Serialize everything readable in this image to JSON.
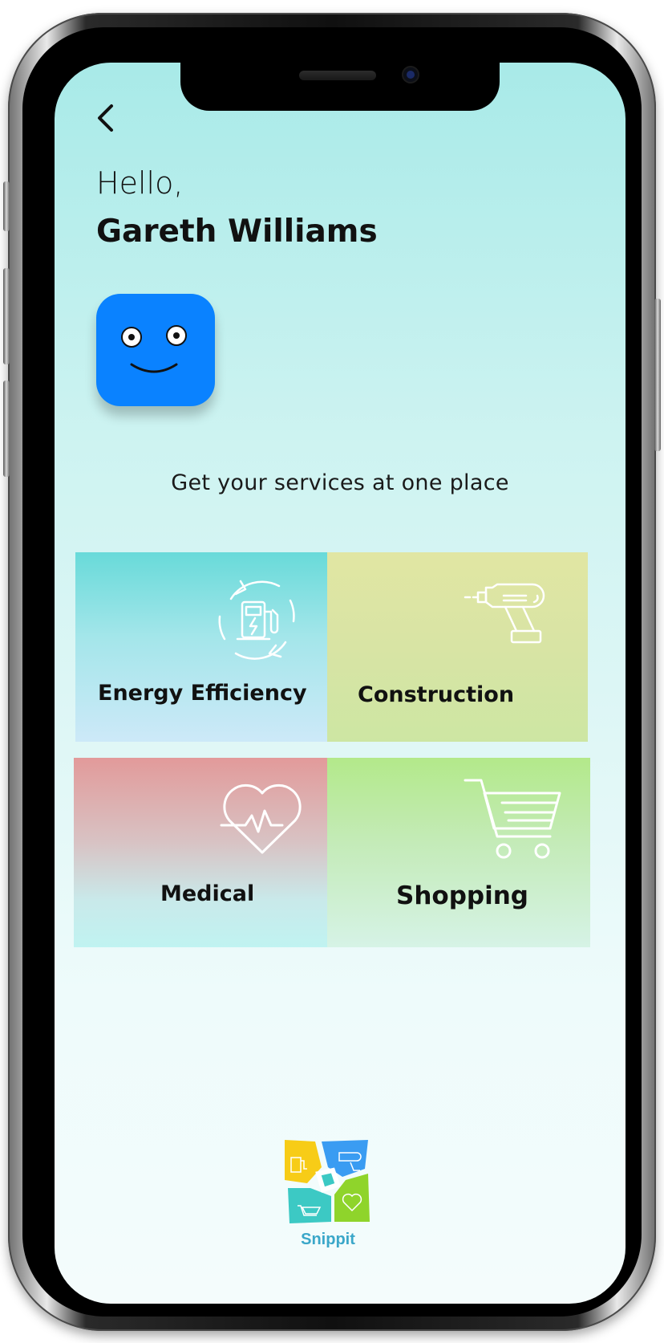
{
  "header": {
    "back_icon": "chevron-left-icon",
    "greeting": "Hello,",
    "user_name": "Gareth Williams"
  },
  "avatar": {
    "icon": "smiley-face-icon",
    "color": "#0a82ff"
  },
  "tagline": "Get your services at one place",
  "services": [
    {
      "label": "Energy Efficiency",
      "icon": "ev-charging-station-icon"
    },
    {
      "label": "Construction",
      "icon": "power-drill-icon"
    },
    {
      "label": "Medical",
      "icon": "heart-pulse-icon"
    },
    {
      "label": "Shopping",
      "icon": "shopping-cart-icon"
    }
  ],
  "footer": {
    "logo_text": "Snippit"
  },
  "colors": {
    "accent": "#0a82ff",
    "logo_text": "#3aa7c9"
  }
}
